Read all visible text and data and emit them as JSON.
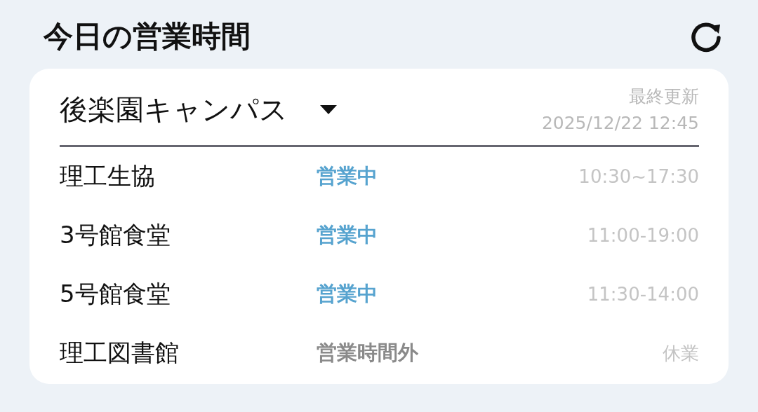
{
  "header": {
    "title": "今日の営業時間"
  },
  "campus": {
    "selected": "後楽園キャンパス",
    "updated_label": "最終更新",
    "updated_at": "2025/12/22 12:45"
  },
  "facilities": [
    {
      "name": "理工生協",
      "status": "営業中",
      "open": true,
      "hours": "10:30~17:30"
    },
    {
      "name": "3号館食堂",
      "status": "営業中",
      "open": true,
      "hours": "11:00-19:00"
    },
    {
      "name": "5号館食堂",
      "status": "営業中",
      "open": true,
      "hours": "11:30-14:00"
    },
    {
      "name": "理工図書館",
      "status": "営業時間外",
      "open": false,
      "hours": "休業"
    }
  ]
}
